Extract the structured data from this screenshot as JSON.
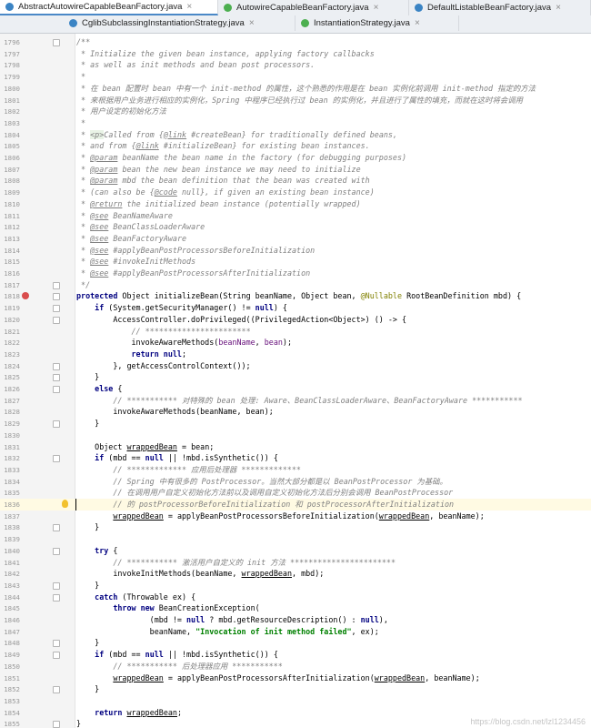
{
  "tabs_row1": [
    {
      "label": "AbstractAutowireCapableBeanFactory.java",
      "active": true,
      "icon_color": "#3b84c4",
      "w": 240
    },
    {
      "label": "AutowireCapableBeanFactory.java",
      "active": false,
      "icon_color": "#4caf50",
      "w": 210
    },
    {
      "label": "DefaultListableBeanFactory.java",
      "active": false,
      "icon_color": "#3b84c4",
      "w": 200
    }
  ],
  "tabs_row2": [
    {
      "label": "CglibSubclassingInstantiationStrategy.java",
      "active": false,
      "icon_color": "#3b84c4",
      "w": 255
    },
    {
      "label": "InstantiationStrategy.java",
      "active": false,
      "icon_color": "#4caf50",
      "w": 180
    }
  ],
  "tab_close": "×",
  "colors": {
    "keyword": "#000080",
    "comment": "#808080",
    "string": "#008000",
    "field": "#660e7a",
    "annotation": "#808000",
    "link": "#808080",
    "tag": "#808080"
  },
  "lines": [
    {
      "n": "1796",
      "t": [
        [
          "c",
          "/**"
        ]
      ]
    },
    {
      "n": "1797",
      "t": [
        [
          "c",
          " * Initialize the given bean instance, applying factory callbacks"
        ]
      ]
    },
    {
      "n": "1798",
      "t": [
        [
          "c",
          " * as well as init methods and bean post processors."
        ]
      ]
    },
    {
      "n": "1799",
      "t": [
        [
          "c",
          " *"
        ]
      ]
    },
    {
      "n": "1800",
      "t": [
        [
          "c",
          " * 在 bean 配置时 bean 中有一个 init-method 的属性，这个熟悉的作用是在 bean 实例化前调用 init-method 指定的方法"
        ]
      ]
    },
    {
      "n": "1801",
      "t": [
        [
          "c",
          " * 来根据用户业务进行相应的实例化，Spring 中程序已经执行过 bean 的实例化，并且进行了属性的填充，而就在这时将会调用"
        ]
      ]
    },
    {
      "n": "1802",
      "t": [
        [
          "c",
          " * 用户设定的初始化方法"
        ]
      ]
    },
    {
      "n": "1803",
      "t": [
        [
          "c",
          " *"
        ]
      ]
    },
    {
      "n": "1804",
      "t": [
        [
          "c",
          " * "
        ],
        [
          "tag",
          "<p>"
        ],
        [
          "c",
          "Called from {"
        ],
        [
          "link",
          "@link"
        ],
        [
          "c",
          " #createBean} for traditionally defined beans,"
        ]
      ]
    },
    {
      "n": "1805",
      "t": [
        [
          "c",
          " * and from {"
        ],
        [
          "link",
          "@link"
        ],
        [
          "c",
          " #initializeBean} for existing bean instances."
        ]
      ]
    },
    {
      "n": "1806",
      "t": [
        [
          "c",
          " * "
        ],
        [
          "link",
          "@param"
        ],
        [
          "c",
          " beanName the bean name in the factory (for debugging purposes)"
        ]
      ]
    },
    {
      "n": "1807",
      "t": [
        [
          "c",
          " * "
        ],
        [
          "link",
          "@param"
        ],
        [
          "c",
          " bean the new bean instance we may need to initialize"
        ]
      ]
    },
    {
      "n": "1808",
      "t": [
        [
          "c",
          " * "
        ],
        [
          "link",
          "@param"
        ],
        [
          "c",
          " mbd the bean definition that the bean was created with"
        ]
      ]
    },
    {
      "n": "1809",
      "t": [
        [
          "c",
          " * (can also be {"
        ],
        [
          "link",
          "@code"
        ],
        [
          "c",
          " null}, if given an existing bean instance)"
        ]
      ]
    },
    {
      "n": "1810",
      "t": [
        [
          "c",
          " * "
        ],
        [
          "link",
          "@return"
        ],
        [
          "c",
          " the initialized bean instance (potentially wrapped)"
        ]
      ]
    },
    {
      "n": "1811",
      "t": [
        [
          "c",
          " * "
        ],
        [
          "link",
          "@see"
        ],
        [
          "c",
          " BeanNameAware"
        ]
      ]
    },
    {
      "n": "1812",
      "t": [
        [
          "c",
          " * "
        ],
        [
          "link",
          "@see"
        ],
        [
          "c",
          " BeanClassLoaderAware"
        ]
      ]
    },
    {
      "n": "1813",
      "t": [
        [
          "c",
          " * "
        ],
        [
          "link",
          "@see"
        ],
        [
          "c",
          " BeanFactoryAware"
        ]
      ]
    },
    {
      "n": "1814",
      "t": [
        [
          "c",
          " * "
        ],
        [
          "link",
          "@see"
        ],
        [
          "c",
          " #applyBeanPostProcessorsBeforeInitialization"
        ]
      ]
    },
    {
      "n": "1815",
      "t": [
        [
          "c",
          " * "
        ],
        [
          "link",
          "@see"
        ],
        [
          "c",
          " #invokeInitMethods"
        ]
      ]
    },
    {
      "n": "1816",
      "t": [
        [
          "c",
          " * "
        ],
        [
          "link",
          "@see"
        ],
        [
          "c",
          " #applyBeanPostProcessorsAfterInitialization"
        ]
      ]
    },
    {
      "n": "1817",
      "t": [
        [
          "c",
          " */"
        ]
      ]
    },
    {
      "n": "1818",
      "t": [
        [
          "k",
          "protected"
        ],
        [
          "p",
          " Object initializeBean(String beanName, Object bean, "
        ],
        [
          "a",
          "@Nullable"
        ],
        [
          "p",
          " RootBeanDefinition mbd) {"
        ]
      ]
    },
    {
      "n": "1819",
      "t": [
        [
          "p",
          "    "
        ],
        [
          "k",
          "if"
        ],
        [
          "p",
          " (System.getSecurityManager() != "
        ],
        [
          "k",
          "null"
        ],
        [
          "p",
          ") {"
        ]
      ]
    },
    {
      "n": "1820",
      "t": [
        [
          "p",
          "        AccessController.doPrivileged((PrivilegedAction<Object>) () -> {"
        ]
      ]
    },
    {
      "n": "1821",
      "t": [
        [
          "p",
          "            "
        ],
        [
          "c",
          "// ***********************"
        ]
      ]
    },
    {
      "n": "1822",
      "t": [
        [
          "p",
          "            invokeAwareMethods("
        ],
        [
          "f",
          "beanName"
        ],
        [
          "p",
          ", "
        ],
        [
          "f",
          "bean"
        ],
        [
          "p",
          ");"
        ]
      ]
    },
    {
      "n": "1823",
      "t": [
        [
          "p",
          "            "
        ],
        [
          "k",
          "return null"
        ],
        [
          "p",
          ";"
        ]
      ]
    },
    {
      "n": "1824",
      "t": [
        [
          "p",
          "        }, getAccessControlContext());"
        ]
      ]
    },
    {
      "n": "1825",
      "t": [
        [
          "p",
          "    }"
        ]
      ]
    },
    {
      "n": "1826",
      "t": [
        [
          "p",
          "    "
        ],
        [
          "k",
          "else"
        ],
        [
          "p",
          " {"
        ]
      ]
    },
    {
      "n": "1827",
      "t": [
        [
          "p",
          "        "
        ],
        [
          "c",
          "// *********** 对特殊的 bean 处理: Aware、BeanClassLoaderAware、BeanFactoryAware ***********"
        ]
      ]
    },
    {
      "n": "1828",
      "t": [
        [
          "p",
          "        invokeAwareMethods(beanName, bean);"
        ]
      ]
    },
    {
      "n": "1829",
      "t": [
        [
          "p",
          "    }"
        ]
      ]
    },
    {
      "n": "1830",
      "t": [
        [
          "p",
          ""
        ]
      ]
    },
    {
      "n": "1831",
      "t": [
        [
          "p",
          "    Object "
        ],
        [
          "u",
          "wrappedBean"
        ],
        [
          "p",
          " = bean;"
        ]
      ]
    },
    {
      "n": "1832",
      "t": [
        [
          "p",
          "    "
        ],
        [
          "k",
          "if"
        ],
        [
          "p",
          " (mbd == "
        ],
        [
          "k",
          "null"
        ],
        [
          "p",
          " || !mbd.isSynthetic()) {"
        ]
      ]
    },
    {
      "n": "1833",
      "t": [
        [
          "p",
          "        "
        ],
        [
          "c",
          "// ************* 应用后处理器 *************"
        ]
      ]
    },
    {
      "n": "1834",
      "t": [
        [
          "p",
          "        "
        ],
        [
          "c",
          "// Spring 中有很多的 PostProcessor。当然大部分都是以 BeanPostProcessor 为基础。"
        ]
      ]
    },
    {
      "n": "1835",
      "t": [
        [
          "p",
          "        "
        ],
        [
          "c",
          "// 在调用用户自定义初始化方法前以及调用自定义初始化方法后分别会调用 BeanPostProcessor"
        ]
      ]
    },
    {
      "n": "1836",
      "cur": true,
      "t": [
        [
          "p",
          "        "
        ],
        [
          "c",
          "// 的 postProcessorBeforeInitialization 和 postProcessorAfterInitialization"
        ]
      ]
    },
    {
      "n": "1837",
      "t": [
        [
          "p",
          "        "
        ],
        [
          "u",
          "wrappedBean"
        ],
        [
          "p",
          " = applyBeanPostProcessorsBeforeInitialization("
        ],
        [
          "u",
          "wrappedBean"
        ],
        [
          "p",
          ", beanName);"
        ]
      ]
    },
    {
      "n": "1838",
      "t": [
        [
          "p",
          "    }"
        ]
      ]
    },
    {
      "n": "1839",
      "t": [
        [
          "p",
          ""
        ]
      ]
    },
    {
      "n": "1840",
      "t": [
        [
          "p",
          "    "
        ],
        [
          "k",
          "try"
        ],
        [
          "p",
          " {"
        ]
      ]
    },
    {
      "n": "1841",
      "t": [
        [
          "p",
          "        "
        ],
        [
          "c",
          "// *********** 激活用户自定义的 init 方法 ***********************"
        ]
      ]
    },
    {
      "n": "1842",
      "t": [
        [
          "p",
          "        invokeInitMethods(beanName, "
        ],
        [
          "u",
          "wrappedBean"
        ],
        [
          "p",
          ", mbd);"
        ]
      ]
    },
    {
      "n": "1843",
      "t": [
        [
          "p",
          "    }"
        ]
      ]
    },
    {
      "n": "1844",
      "t": [
        [
          "p",
          "    "
        ],
        [
          "k",
          "catch"
        ],
        [
          "p",
          " (Throwable ex) {"
        ]
      ]
    },
    {
      "n": "1845",
      "t": [
        [
          "p",
          "        "
        ],
        [
          "k",
          "throw new"
        ],
        [
          "p",
          " BeanCreationException("
        ]
      ]
    },
    {
      "n": "1846",
      "t": [
        [
          "p",
          "                (mbd != "
        ],
        [
          "k",
          "null"
        ],
        [
          "p",
          " ? mbd.getResourceDescription() : "
        ],
        [
          "k",
          "null"
        ],
        [
          "p",
          "),"
        ]
      ]
    },
    {
      "n": "1847",
      "t": [
        [
          "p",
          "                beanName, "
        ],
        [
          "s",
          "\"Invocation of init method failed\""
        ],
        [
          "p",
          ", ex);"
        ]
      ]
    },
    {
      "n": "1848",
      "t": [
        [
          "p",
          "    }"
        ]
      ]
    },
    {
      "n": "1849",
      "t": [
        [
          "p",
          "    "
        ],
        [
          "k",
          "if"
        ],
        [
          "p",
          " (mbd == "
        ],
        [
          "k",
          "null"
        ],
        [
          "p",
          " || !mbd.isSynthetic()) {"
        ]
      ]
    },
    {
      "n": "1850",
      "t": [
        [
          "p",
          "        "
        ],
        [
          "c",
          "// *********** 后处理器应用 ***********"
        ]
      ]
    },
    {
      "n": "1851",
      "t": [
        [
          "p",
          "        "
        ],
        [
          "u",
          "wrappedBean"
        ],
        [
          "p",
          " = applyBeanPostProcessorsAfterInitialization("
        ],
        [
          "u",
          "wrappedBean"
        ],
        [
          "p",
          ", beanName);"
        ]
      ]
    },
    {
      "n": "1852",
      "t": [
        [
          "p",
          "    }"
        ]
      ]
    },
    {
      "n": "1853",
      "t": [
        [
          "p",
          ""
        ]
      ]
    },
    {
      "n": "1854",
      "t": [
        [
          "p",
          "    "
        ],
        [
          "k",
          "return"
        ],
        [
          "p",
          " "
        ],
        [
          "u",
          "wrappedBean"
        ],
        [
          "p",
          ";"
        ]
      ]
    },
    {
      "n": "1855",
      "t": [
        [
          "p",
          "}"
        ]
      ]
    }
  ],
  "watermark": "https://blog.csdn.net/lzl1234456"
}
